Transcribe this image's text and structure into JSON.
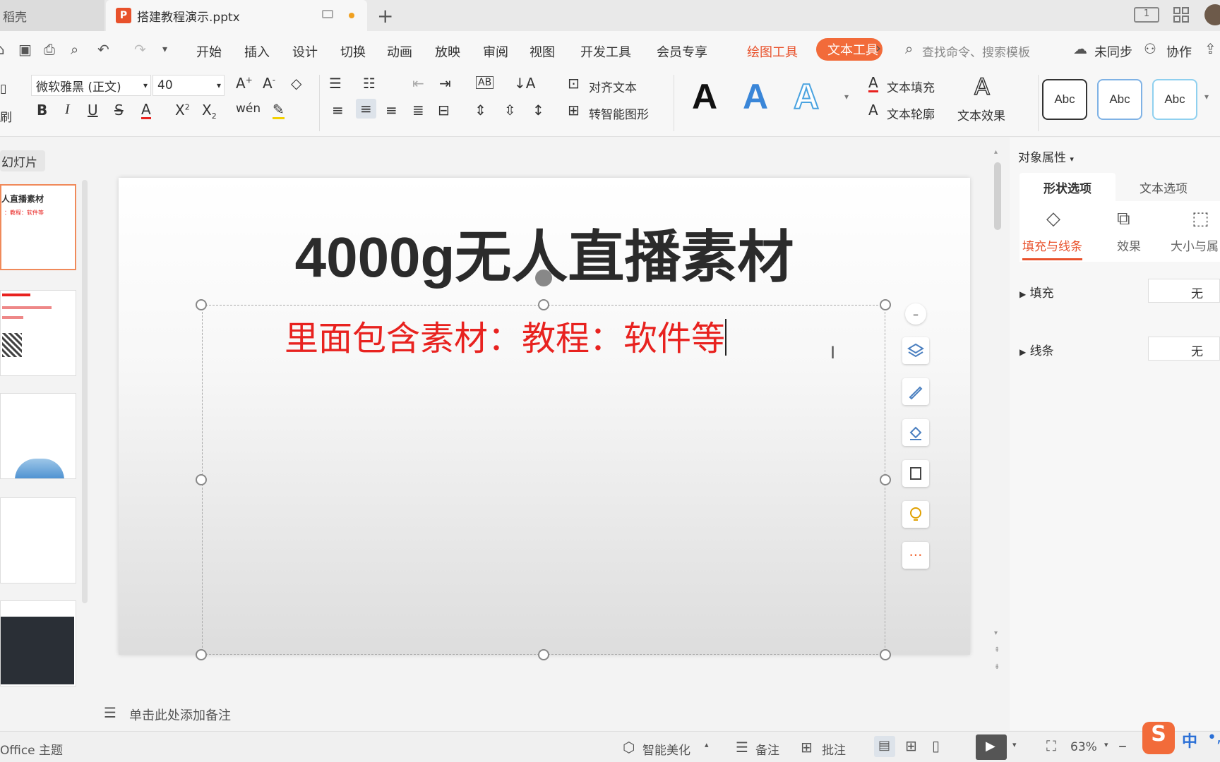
{
  "tabs": {
    "home": "稻壳",
    "doc": "搭建教程演示.pptx",
    "doc_icon": "P"
  },
  "menu": {
    "items": [
      "开始",
      "插入",
      "设计",
      "切换",
      "动画",
      "放映",
      "审阅",
      "视图",
      "开发工具",
      "会员专享"
    ],
    "drawing_tool": "绘图工具",
    "text_tool": "文本工具",
    "search": "查找命令、搜索模板",
    "unsynced": "未同步",
    "collab": "协作"
  },
  "ribbon": {
    "format_painter": "刷",
    "font_name": "微软雅黑 (正文)",
    "font_size": "40",
    "align_text": "对齐文本",
    "smart_shape": "转智能图形",
    "text_fill": "文本填充",
    "text_outline": "文本轮廓",
    "text_effect": "文本效果",
    "big_a": "A",
    "abc": "Abc"
  },
  "slides_panel": {
    "label": "幻灯片",
    "thumb1_title": "人直播素材",
    "thumb1_sub": "：教程：软件等"
  },
  "slide": {
    "title": "4000g无人直播素材",
    "subtitle": "里面包含素材：教程：软件等"
  },
  "right_pane": {
    "header": "对象属性",
    "tab_shape": "形状选项",
    "tab_text": "文本选项",
    "sub_fill_line": "填充与线条",
    "sub_effect": "效果",
    "sub_size": "大小与属",
    "fill_label": "填充",
    "fill_value": "无",
    "line_label": "线条",
    "line_value": "无"
  },
  "notes": {
    "placeholder": "单击此处添加备注"
  },
  "status": {
    "theme": "Office 主题",
    "beautify": "智能美化",
    "notes": "备注",
    "comment": "批注",
    "zoom": "63%",
    "ime": "中"
  },
  "colors": {
    "accent": "#f26b3a",
    "subtitle_red": "#e8221f"
  }
}
